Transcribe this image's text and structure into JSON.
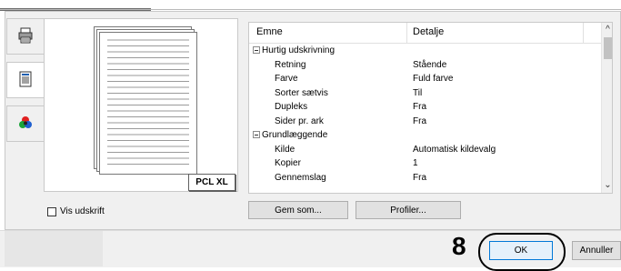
{
  "tabs": [
    {
      "icon": "printer-icon"
    },
    {
      "icon": "document-icon"
    },
    {
      "icon": "color-icon"
    }
  ],
  "preview": {
    "badge": "PCL XL"
  },
  "properties": {
    "columns": {
      "item": "Emne",
      "detail": "Detalje"
    },
    "rows": [
      {
        "type": "group",
        "item": "Hurtig udskrivning",
        "value": ""
      },
      {
        "type": "item",
        "item": "Retning",
        "value": "Stående"
      },
      {
        "type": "item",
        "item": "Farve",
        "value": "Fuld farve"
      },
      {
        "type": "item",
        "item": "Sorter sætvis",
        "value": "Til"
      },
      {
        "type": "item",
        "item": "Dupleks",
        "value": "Fra"
      },
      {
        "type": "item",
        "item": "Sider pr. ark",
        "value": "Fra"
      },
      {
        "type": "group",
        "item": "Grundlæggende",
        "value": ""
      },
      {
        "type": "item",
        "item": "Kilde",
        "value": "Automatisk kildevalg"
      },
      {
        "type": "item",
        "item": "Kopier",
        "value": "1"
      },
      {
        "type": "item",
        "item": "Gennemslag",
        "value": "Fra"
      }
    ]
  },
  "checkbox": {
    "label": "Vis udskrift",
    "checked": false
  },
  "buttons": {
    "save_as": "Gem som...",
    "profiles": "Profiler...",
    "ok": "OK",
    "cancel": "Annuller"
  },
  "callout": {
    "number": "8"
  }
}
